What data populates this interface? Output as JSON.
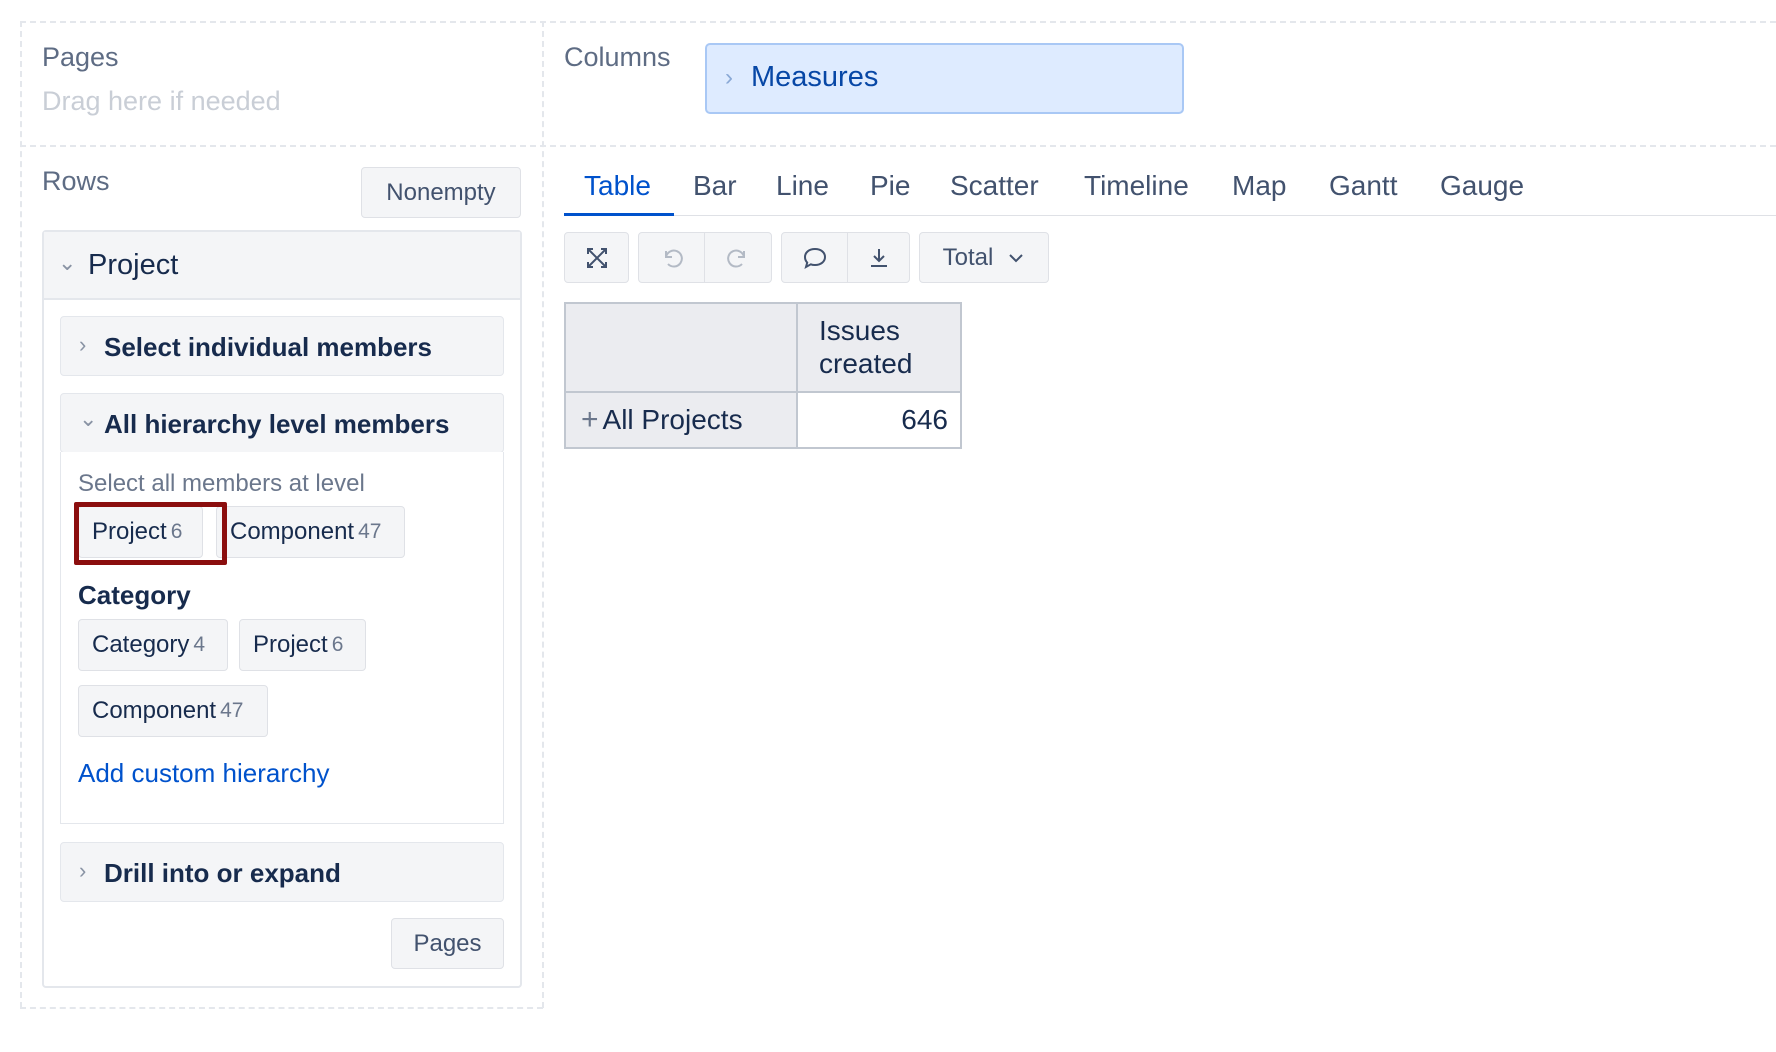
{
  "pages": {
    "title": "Pages",
    "placeholder": "Drag here if needed"
  },
  "columns": {
    "title": "Columns",
    "chip_label": "Measures"
  },
  "rows": {
    "title": "Rows",
    "nonempty_button": "Nonempty",
    "dimension": "Project",
    "select_individual": "Select individual members",
    "all_hierarchy": "All hierarchy level members",
    "select_all_hint": "Select all members at level",
    "default_levels": [
      {
        "label": "Project",
        "count": "6"
      },
      {
        "label": "Component",
        "count": "47"
      }
    ],
    "category_title": "Category",
    "category_levels": [
      {
        "label": "Category",
        "count": "4"
      },
      {
        "label": "Project",
        "count": "6"
      },
      {
        "label": "Component",
        "count": "47"
      }
    ],
    "add_custom": "Add custom hierarchy",
    "drill": "Drill into or expand",
    "pages_button": "Pages"
  },
  "tabs": [
    "Table",
    "Bar",
    "Line",
    "Pie",
    "Scatter",
    "Timeline",
    "Map",
    "Gantt",
    "Gauge"
  ],
  "active_tab": "Table",
  "toolbar": {
    "total_label": "Total"
  },
  "table": {
    "header": "Issues created",
    "header_line1": "Issues",
    "header_line2": "created",
    "row_label": "All Projects",
    "value": "646"
  },
  "colors": {
    "accent": "#0052cc",
    "highlight": "#8b0e0e",
    "chip_bg": "#deebff"
  }
}
